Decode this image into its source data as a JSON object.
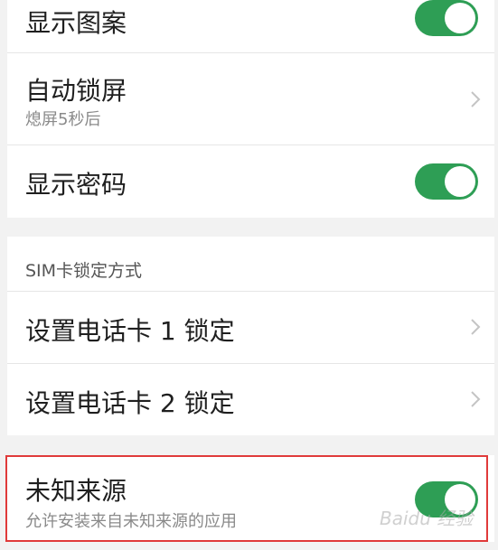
{
  "settings": {
    "show_pattern": {
      "label": "显示图案",
      "enabled": true
    },
    "auto_lock": {
      "label": "自动锁屏",
      "value": "熄屏5秒后"
    },
    "show_password": {
      "label": "显示密码",
      "enabled": true
    },
    "sim_lock_section": {
      "label": "SIM卡锁定方式"
    },
    "sim1_lock": {
      "label": "设置电话卡 1 锁定"
    },
    "sim2_lock": {
      "label": "设置电话卡 2 锁定"
    },
    "unknown_sources": {
      "label": "未知来源",
      "description": "允许安装来自未知来源的应用",
      "enabled": true
    }
  },
  "watermark": {
    "text": "Baidu 经验"
  },
  "colors": {
    "toggle_on": "#2e9e55",
    "highlight": "#e03a3a",
    "background": "#f2f2f2"
  },
  "icons": {
    "chevron": "chevron-right-icon"
  }
}
